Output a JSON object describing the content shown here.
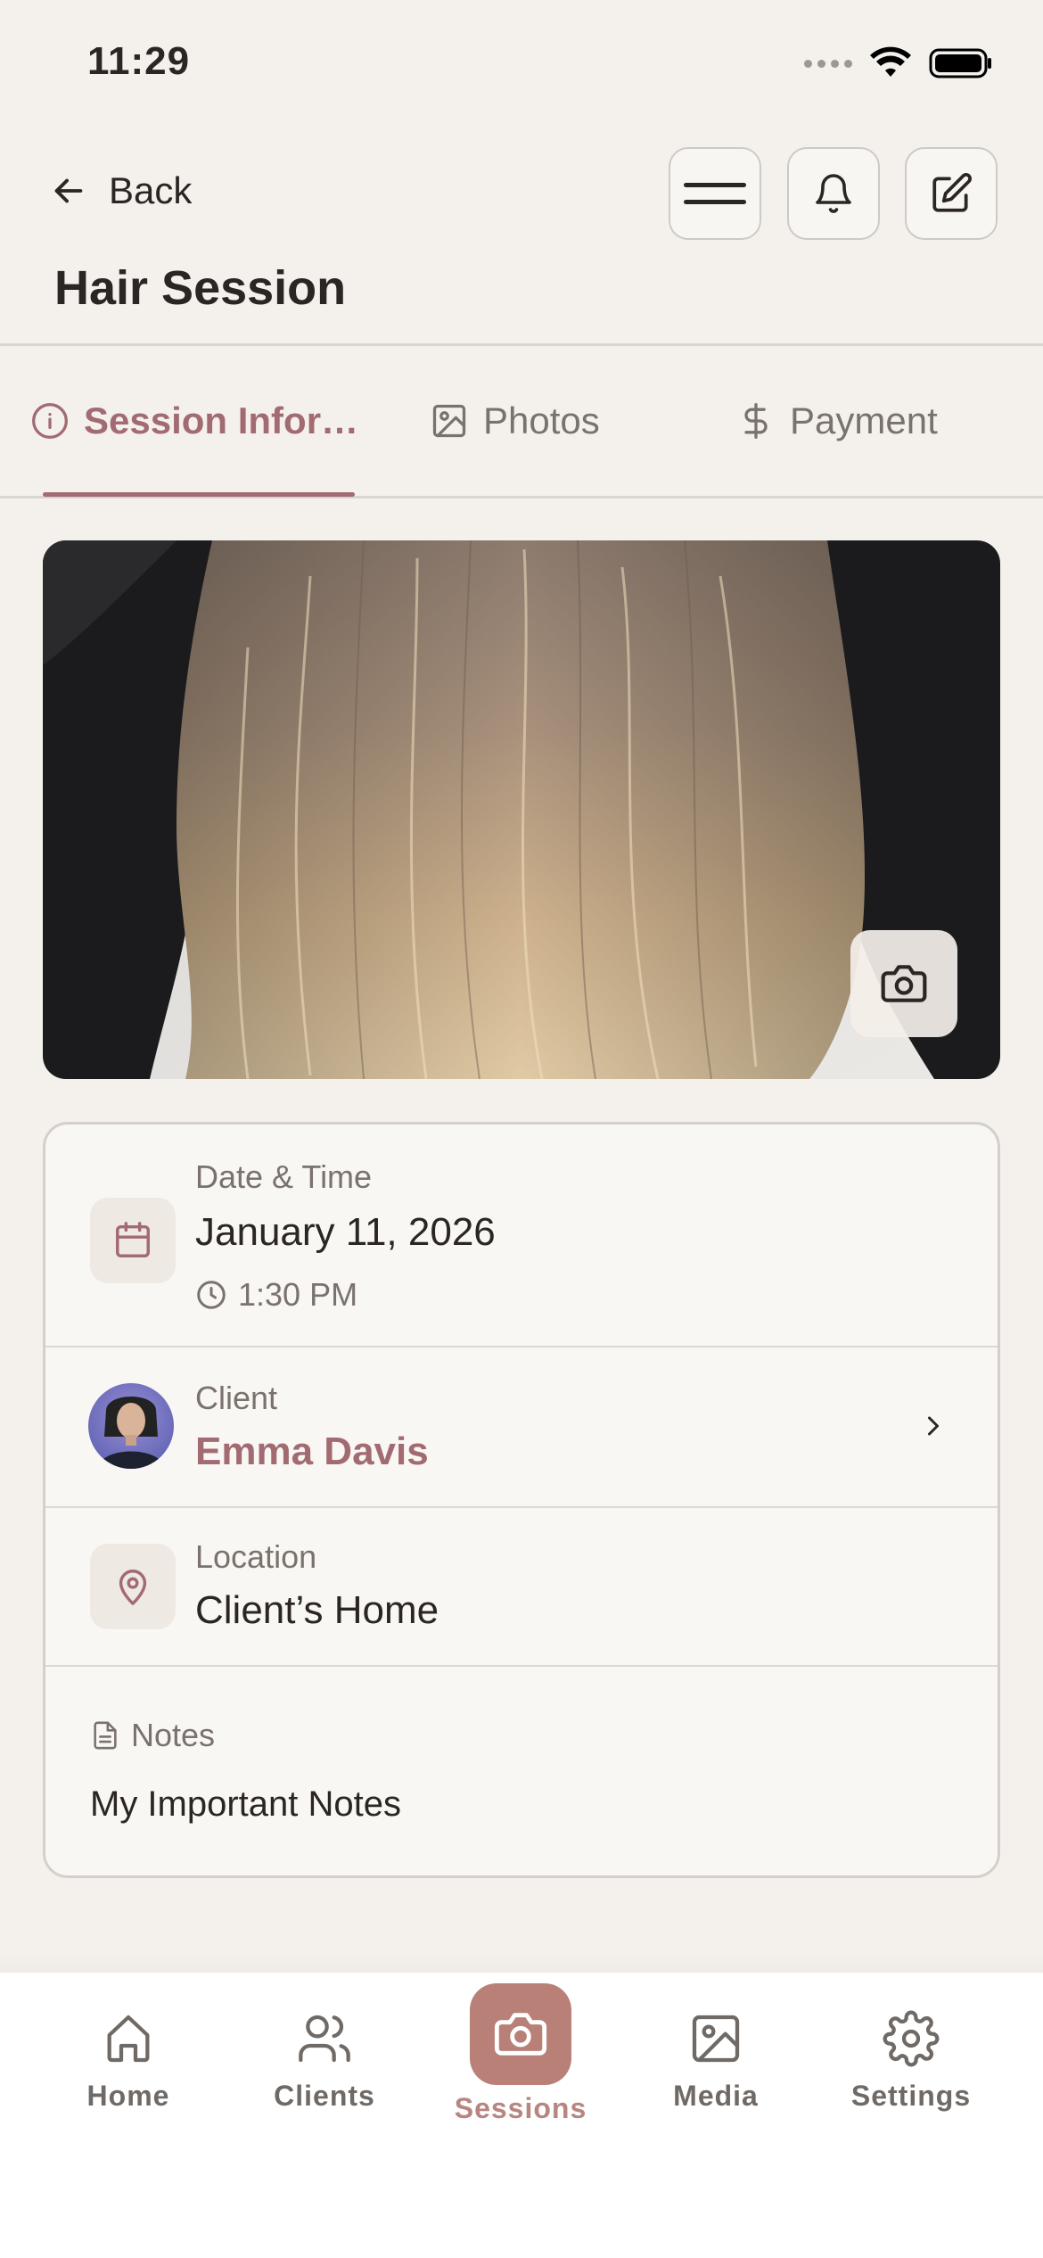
{
  "status_bar": {
    "time": "11:29"
  },
  "header": {
    "back_label": "Back",
    "title": "Hair Session"
  },
  "tabs": [
    {
      "label": "Session Infor…",
      "icon": "info-icon",
      "active": true
    },
    {
      "label": "Photos",
      "icon": "image-icon",
      "active": false
    },
    {
      "label": "Payment",
      "icon": "dollar-icon",
      "active": false
    }
  ],
  "session": {
    "date_label": "Date & Time",
    "date_value": "January 11, 2026",
    "time_value": "1:30 PM",
    "client_label": "Client",
    "client_name": "Emma Davis",
    "location_label": "Location",
    "location_value": "Client’s Home",
    "notes_label": "Notes",
    "notes_value": "My Important Notes"
  },
  "bottom_nav": [
    {
      "label": "Home",
      "icon": "home-icon",
      "active": false
    },
    {
      "label": "Clients",
      "icon": "users-icon",
      "active": false
    },
    {
      "label": "Sessions",
      "icon": "camera-icon",
      "active": true
    },
    {
      "label": "Media",
      "icon": "image-icon",
      "active": false
    },
    {
      "label": "Settings",
      "icon": "gear-icon",
      "active": false
    }
  ],
  "colors": {
    "background": "#f4f1ed",
    "accent": "#a26b72",
    "active_nav_bg": "#b98077",
    "text": "#2b2623"
  }
}
